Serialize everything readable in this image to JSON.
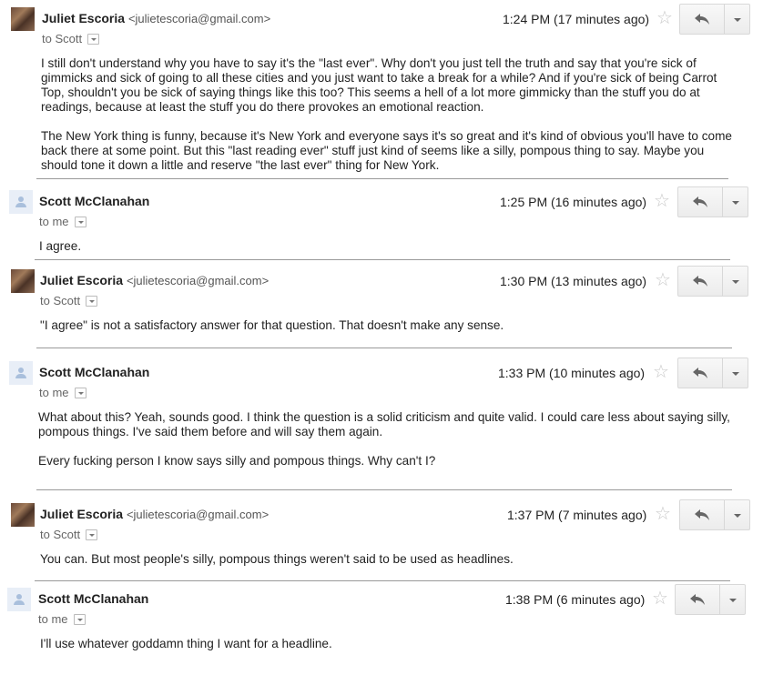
{
  "messages": [
    {
      "sender": "Juliet Escoria",
      "email": "<julietescoria@gmail.com>",
      "recipient": "to Scott",
      "time": "1:24 PM (17 minutes ago)",
      "avatar": "photo",
      "body": [
        "I still don't understand why you have to say it's the \"last ever\". Why don't you just tell the truth and say that you're sick of gimmicks and sick of going to all these cities and you just want to take a break for a while? And if you're sick of being Carrot Top, shouldn't you be sick of saying things like this too? This seems a hell of a lot more gimmicky than the stuff you do at readings, because at least the stuff you do there provokes an emotional reaction.",
        "The New York thing is funny, because it's New York and everyone says it's so great and it's kind of obvious you'll have to come back there at some point. But this \"last reading ever\" stuff just kind of seems like a silly, pompous thing to say. Maybe you should tone it down a little and reserve \"the last ever\" thing for New York."
      ]
    },
    {
      "sender": "Scott McClanahan",
      "email": "",
      "recipient": "to me",
      "time": "1:25 PM (16 minutes ago)",
      "avatar": "generic",
      "body": [
        "I agree."
      ]
    },
    {
      "sender": "Juliet Escoria",
      "email": "<julietescoria@gmail.com>",
      "recipient": "to Scott",
      "time": "1:30 PM (13 minutes ago)",
      "avatar": "photo",
      "body": [
        "\"I agree\" is not a satisfactory answer for that question. That doesn't make any sense."
      ]
    },
    {
      "sender": "Scott McClanahan",
      "email": "",
      "recipient": "to me",
      "time": "1:33 PM (10 minutes ago)",
      "avatar": "generic",
      "body": [
        "What about this?  Yeah, sounds good.  I think the question is a solid criticism and quite valid.  I could care less about saying silly, pompous things.  I've said them before and will say them again.",
        "Every fucking person I know says silly and pompous things.  Why can't I?"
      ]
    },
    {
      "sender": "Juliet Escoria",
      "email": "<julietescoria@gmail.com>",
      "recipient": "to Scott",
      "time": "1:37 PM (7 minutes ago)",
      "avatar": "photo",
      "body": [
        "You can. But most people's silly, pompous things weren't said to be used as headlines."
      ]
    },
    {
      "sender": "Scott McClanahan",
      "email": "",
      "recipient": "to me",
      "time": "1:38 PM (6 minutes ago)",
      "avatar": "generic",
      "body": [
        "I'll use whatever goddamn thing I want for a headline."
      ]
    }
  ],
  "icons": {
    "star": "star-icon",
    "reply": "reply-icon",
    "more": "chevron-down-icon"
  }
}
